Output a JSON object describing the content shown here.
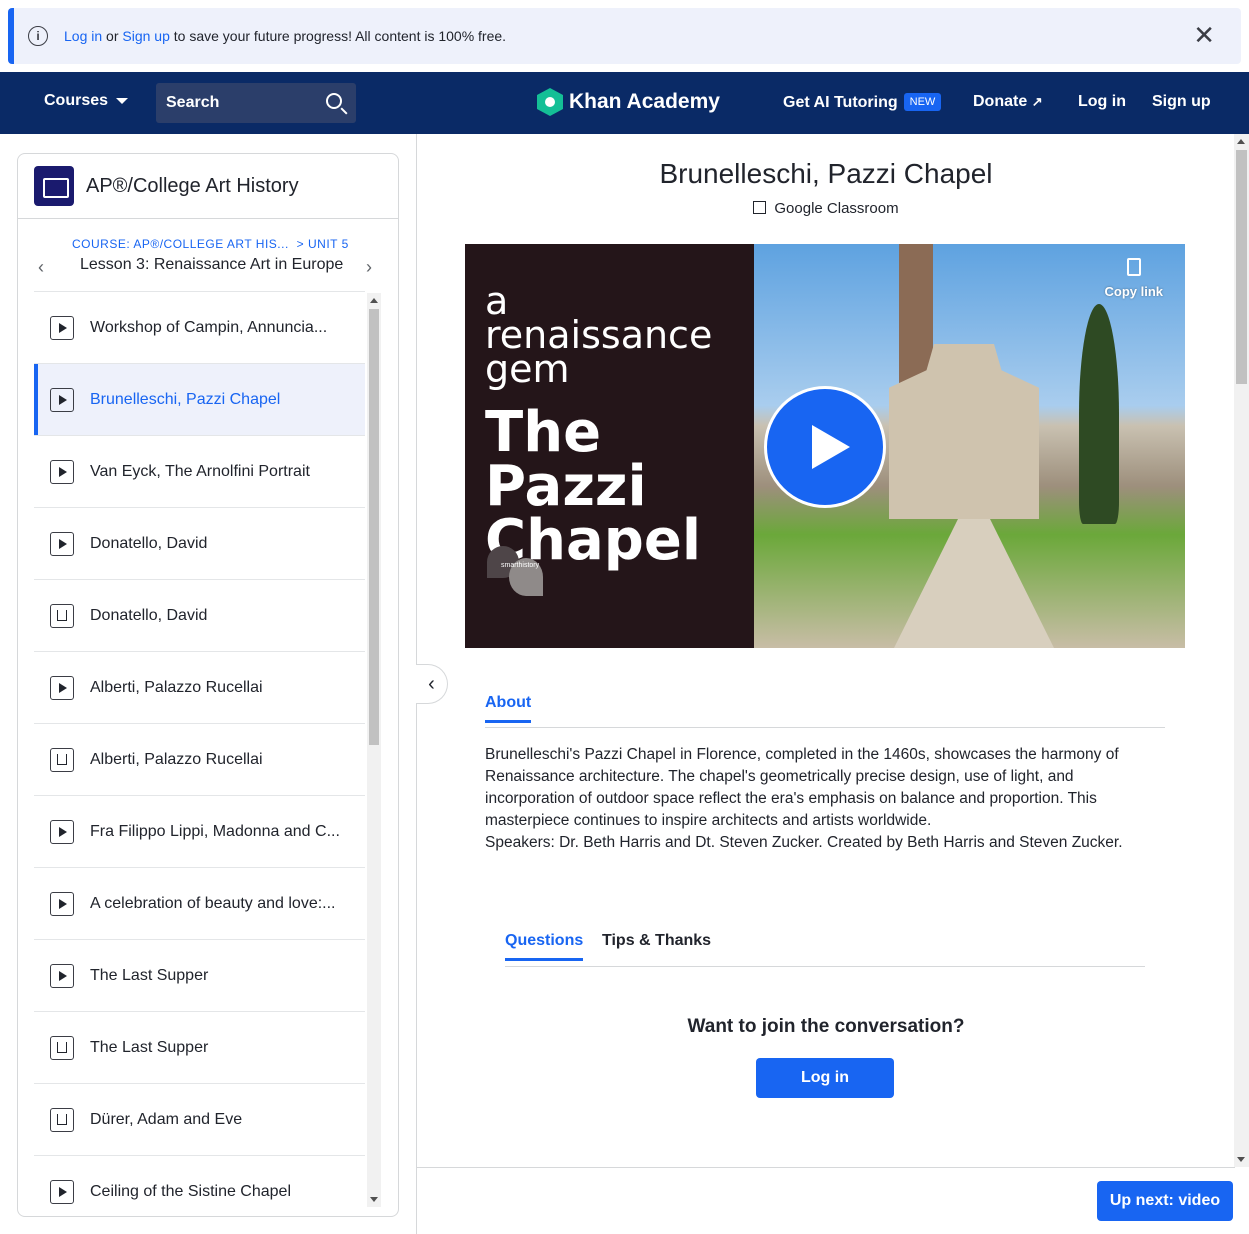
{
  "banner": {
    "login_link": "Log in",
    "or_text": "or",
    "signup_link": "Sign up",
    "message": "to save your future progress! All content is 100% free.",
    "close_icon": "close-icon"
  },
  "nav": {
    "courses": "Courses",
    "search_placeholder": "Search",
    "logo_text": "Khan Academy",
    "ai_tutoring": "Get AI Tutoring",
    "new_badge": "NEW",
    "donate": "Donate",
    "login": "Log in",
    "signup": "Sign up"
  },
  "sidebar": {
    "course_title": "AP®/College Art History",
    "breadcrumb_course": "COURSE: AP®/COLLEGE ART HIS...",
    "breadcrumb_unit": "> UNIT 5",
    "lesson_title": "Lesson 3: Renaissance Art in Europe",
    "items": [
      {
        "label": "Workshop of Campin, Annuncia...",
        "type": "video",
        "active": false
      },
      {
        "label": "Brunelleschi, Pazzi Chapel",
        "type": "video",
        "active": true
      },
      {
        "label": "Van Eyck, The Arnolfini Portrait",
        "type": "video",
        "active": false
      },
      {
        "label": "Donatello, David",
        "type": "video",
        "active": false
      },
      {
        "label": "Donatello, David",
        "type": "article",
        "active": false
      },
      {
        "label": "Alberti, Palazzo Rucellai",
        "type": "video",
        "active": false
      },
      {
        "label": "Alberti, Palazzo Rucellai",
        "type": "article",
        "active": false
      },
      {
        "label": "Fra Filippo Lippi, Madonna and C...",
        "type": "video",
        "active": false
      },
      {
        "label": "A celebration of beauty and love:...",
        "type": "video",
        "active": false
      },
      {
        "label": "The Last Supper",
        "type": "video",
        "active": false
      },
      {
        "label": "The Last Supper",
        "type": "article",
        "active": false
      },
      {
        "label": "Dürer, Adam and Eve",
        "type": "article",
        "active": false
      },
      {
        "label": "Ceiling of the Sistine Chapel",
        "type": "video",
        "active": false
      }
    ]
  },
  "main": {
    "title": "Brunelleschi, Pazzi Chapel",
    "google_classroom": "Google Classroom",
    "video": {
      "line_small": "a renaissance gem",
      "line_big": "The Pazzi Chapel",
      "watermark": "smarthistory",
      "copy_link": "Copy link"
    },
    "tab_about": "About",
    "about_text": "Brunelleschi's Pazzi Chapel in Florence, completed in the 1460s, showcases the harmony of Renaissance architecture. The chapel's geometrically precise design, use of light, and incorporation of outdoor space reflect the era's emphasis on balance and proportion. This masterpiece continues to inspire architects and artists worldwide.",
    "about_speakers": "Speakers: Dr. Beth Harris and Dt. Steven Zucker. Created by Beth Harris and Steven Zucker.",
    "tab_questions": "Questions",
    "tab_tips": "Tips & Thanks",
    "join_prompt": "Want to join the conversation?",
    "login_button": "Log in",
    "up_next": "Up next: video"
  }
}
